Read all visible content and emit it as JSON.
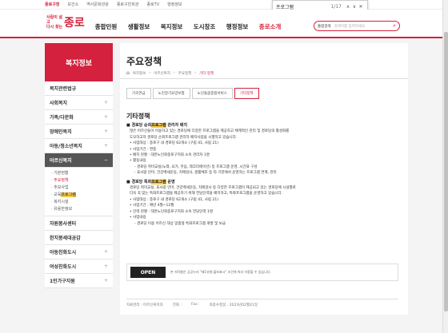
{
  "topbar": {
    "links": [
      "종로구청",
      "보건소",
      "역사문화관광",
      "종로구민회관",
      "종로TV",
      "행정정보"
    ]
  },
  "findbar": {
    "query": "프로그램",
    "count": "1/17",
    "prev": "∧",
    "next": "∨",
    "close": "✕"
  },
  "logo": {
    "line1": "사람이 살고",
    "line2": "다시 찾는",
    "big": "종로"
  },
  "gnb": [
    "종합민원",
    "생활정보",
    "복지정보",
    "도시창조",
    "행정정보",
    "종로소개"
  ],
  "search": {
    "select": "통합검색",
    "placeholder": "검색어를 입력하세요",
    "icon": "search-icon"
  },
  "sidebar": {
    "title": "복지정보",
    "items": [
      {
        "label": "복지관련법규",
        "plus": ""
      },
      {
        "label": "사회복지",
        "plus": "+"
      },
      {
        "label": "가족/다문화",
        "plus": "+"
      },
      {
        "label": "장애인복지",
        "plus": "+"
      },
      {
        "label": "아동/청소년복지",
        "plus": "+"
      },
      {
        "label": "어르신복지",
        "plus": "−"
      }
    ],
    "sub": [
      "· 기본현황",
      "· 주요정책",
      "· 추모사업",
      "· 교육",
      "· 복지시설",
      "· 유용한정보"
    ],
    "sub_hl": "프로그램",
    "items2": [
      {
        "label": "자원봉사센터",
        "plus": ""
      },
      {
        "label": "한지붕세대공감",
        "plus": ""
      },
      {
        "label": "아동친화도시",
        "plus": "+"
      },
      {
        "label": "여성친화도시",
        "plus": "+"
      },
      {
        "label": "1인가구지원",
        "plus": "+"
      }
    ]
  },
  "page": {
    "title": "주요정책",
    "breadcrumb": [
      "복지정보",
      "어르신복지",
      "주요정책",
      "기타 정책"
    ],
    "tabs": [
      "기초연금",
      "노인장기요양보험",
      "노인돌봄종합서비스",
      "기타정책"
    ],
    "section": "기타정책",
    "b1_pre": "경로당 순회",
    "b1_hl": "프로그램",
    "b1_post": " 관리자 배치",
    "b1_lines": [
      "많은 어르신들이 이용하고 있는 경로당에 다양한 프로그램을 제공하고 체계적인 관리 및 경로당의 활성화를",
      "도모하고자 경로당 순회프로그램 관리자 배치사업을 시행하고 있습니다.",
      "사업대상 : 종로구 내 경로당 62개소 (구립 41, 사립 21)",
      "사업기간 : 연중",
      "배치 현황 : 대한노인회종로구지회 소속 관리자 1명",
      "활동내용",
      "경로당 취미교실(노래, 요가, 웃음, 레크리에이션) 등 프로그램 운영, 시간표 구성",
      "효사랑 안마, 건강백세운동, 치매검사, 생활체조 등 타 기관에서 운영하는 프로그램 연계, 관리"
    ],
    "b2_pre": "경로당 특화",
    "b2_hl": "프로그램",
    "b2_post": " 운영",
    "b2_lines": [
      "경로당 취미교실, 효사랑 안마, 건강백세운동, 치매검사 등 다양한 프로그램이 제공되고 있는 경로당에 시설별로",
      "다욱 꼭 맞는 특화프로그램을 제공하기 위해 전담인력을 배치하고, 특화프로그램을 운영하고 있습니다.",
      "사업대상 : 종로구 내 경로당 62개소 (구립 41, 사립 21)",
      "사업기간 : 매년 4월~12월",
      "인력 현황 : 대한노인회종로구지회 소속 전담인력 1명",
      "사업내용",
      "경로당 이용 어르신 대상 맞춤형 특화프로그램 개발 및 보급"
    ],
    "license": "OPEN",
    "license_text": "본 저작물은 공공누리 \"제1유형:출처표시\" 조건에 따라 이용할 수 있습니다.",
    "footer": [
      "자료관리 : 어르신복지과",
      "전화 :",
      "Fax :",
      "최종수정일 : 2023년02월21일"
    ]
  },
  "colors": {
    "accent": "#d4213d",
    "highlight": "#f7c948"
  }
}
